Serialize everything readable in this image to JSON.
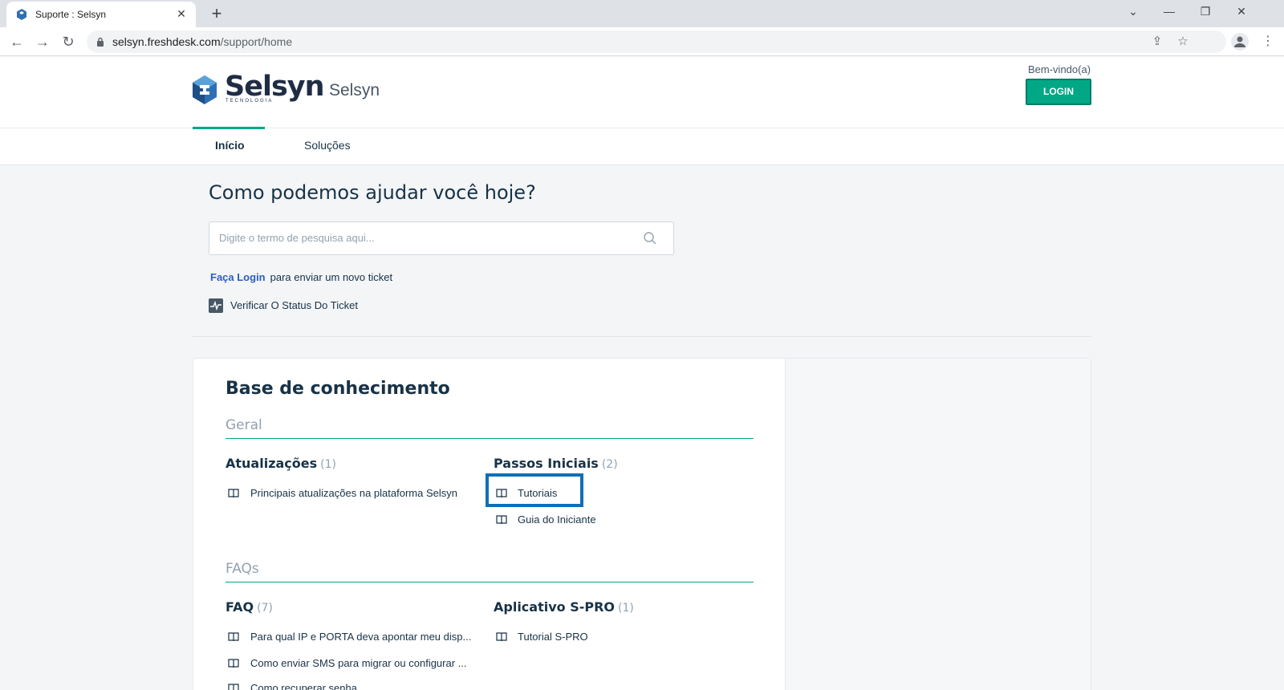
{
  "browser": {
    "tab_title": "Suporte : Selsyn",
    "url_host": "selsyn.freshdesk.com",
    "url_path": "/support/home"
  },
  "header": {
    "logo_text": "Selsyn",
    "logo_subtext": "TECNOLOGIA",
    "brand_name": "Selsyn",
    "welcome": "Bem-vindo(a)",
    "login_button": "LOGIN"
  },
  "nav": {
    "items": [
      {
        "label": "Início",
        "active": true
      },
      {
        "label": "Soluções",
        "active": false
      }
    ]
  },
  "hero": {
    "title": "Como podemos ajudar você hoje?",
    "search_placeholder": "Digite o termo de pesquisa aqui...",
    "login_link": "Faça Login",
    "login_suffix": "para enviar um novo ticket",
    "status_link": "Verificar O Status Do Ticket"
  },
  "knowledge_base": {
    "title": "Base de conhecimento",
    "categories": [
      {
        "name": "Geral",
        "folders": [
          {
            "name": "Atualizações",
            "count": "(1)",
            "articles": [
              "Principais atualizações na plataforma Selsyn"
            ]
          },
          {
            "name": "Passos Iniciais",
            "count": "(2)",
            "articles": [
              "Tutoriais",
              "Guia do Iniciante"
            ]
          }
        ]
      },
      {
        "name": "FAQs",
        "folders": [
          {
            "name": "FAQ",
            "count": "(7)",
            "articles": [
              "Para qual IP e PORTA deva apontar meu disp...",
              "Como enviar SMS para migrar ou configurar ...",
              "Como recuperar senha"
            ]
          },
          {
            "name": "Aplicativo S-PRO",
            "count": "(1)",
            "articles": [
              "Tutorial S-PRO"
            ]
          }
        ]
      }
    ]
  },
  "colors": {
    "accent": "#00a886",
    "highlight": "#0f6fb8",
    "link": "#2c5cc5"
  }
}
